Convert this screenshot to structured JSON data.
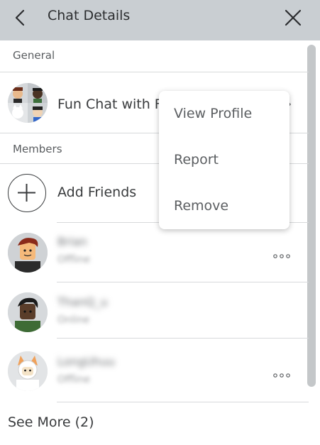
{
  "header": {
    "title": "Chat Details"
  },
  "general": {
    "label": "General",
    "chat_name": "Fun Chat with F"
  },
  "members": {
    "label": "Members",
    "add_friends_label": "Add Friends",
    "list": [
      {
        "name": "Brian",
        "status": "Offline"
      },
      {
        "name": "ThanQ_u",
        "status": "Online"
      },
      {
        "name": "LongUhuu",
        "status": "Offline"
      }
    ],
    "see_more": "See More (2)"
  },
  "context_menu": {
    "items": [
      "View Profile",
      "Report",
      "Remove"
    ]
  },
  "icons": {
    "back": "chevron-left-icon",
    "close": "close-icon",
    "chevron": "chevron-right-icon",
    "more": "more-horizontal-icon",
    "add": "plus-icon"
  },
  "colors": {
    "header_bg": "#c9ced2",
    "text": "#393b3d",
    "divider": "#d7d9db",
    "menu_text": "#5b5e61"
  }
}
